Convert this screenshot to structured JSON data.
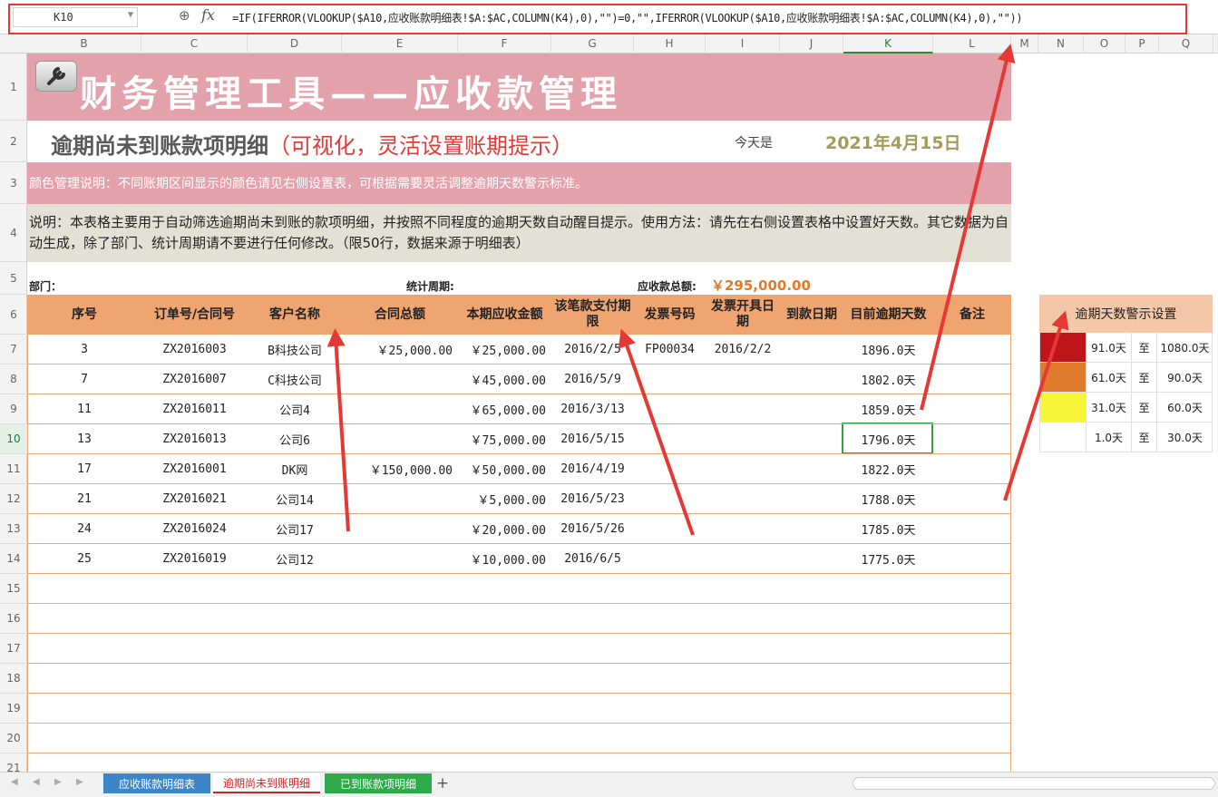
{
  "formula_bar": {
    "cell_ref": "K10",
    "formula": "=IF(IFERROR(VLOOKUP($A10,应收账款明细表!$A:$AC,COLUMN(K4),0),\"\")=0,\"\",IFERROR(VLOOKUP($A10,应收账款明细表!$A:$AC,COLUMN(K4),0),\"\"))"
  },
  "columns": [
    "B",
    "C",
    "D",
    "E",
    "F",
    "G",
    "H",
    "I",
    "J",
    "K",
    "L",
    "M",
    "N",
    "O",
    "P",
    "Q"
  ],
  "rows": [
    "1",
    "2",
    "3",
    "4",
    "5",
    "6",
    "7",
    "8",
    "9",
    "10",
    "11",
    "12",
    "13",
    "14",
    "15",
    "16",
    "17",
    "18",
    "19",
    "20",
    "21"
  ],
  "title": "财务管理工具——应收款管理",
  "subtitle_main": "逾期尚未到账款项明细",
  "subtitle_highlight": "（可视化，灵活设置账期提示）",
  "today_label": "今天是",
  "today_date": "2021年4月15日",
  "color_note": "颜色管理说明：不同账期区间显示的颜色请见右侧设置表，可根据需要灵活调整逾期天数警示标准。",
  "description": "说明：本表格主要用于自动筛选逾期尚未到账的款项明细，并按照不同程度的逾期天数自动醒目提示。使用方法：请先在右侧设置表格中设置好天数。其它数据为自动生成，除了部门、统计周期请不要进行任何修改。（限50行，数据来源于明细表）",
  "info_row": {
    "dept_label": "部门：",
    "period_label": "统计周期:",
    "total_label": "应收款总额:",
    "total_value": "￥295,000.00"
  },
  "table": {
    "headers": [
      "序号",
      "订单号/合同号",
      "客户名称",
      "合同总额",
      "本期应收金额",
      "该笔款支付期限",
      "发票号码",
      "发票开具日期",
      "到款日期",
      "目前逾期天数",
      "备注"
    ],
    "rows": [
      [
        "3",
        "ZX2016003",
        "B科技公司",
        "￥25,000.00",
        "￥25,000.00",
        "2016/2/5",
        "FP00034",
        "2016/2/2",
        "",
        "1896.0天",
        ""
      ],
      [
        "7",
        "ZX2016007",
        "C科技公司",
        "",
        "￥45,000.00",
        "2016/5/9",
        "",
        "",
        "",
        "1802.0天",
        ""
      ],
      [
        "11",
        "ZX2016011",
        "公司4",
        "",
        "￥65,000.00",
        "2016/3/13",
        "",
        "",
        "",
        "1859.0天",
        ""
      ],
      [
        "13",
        "ZX2016013",
        "公司6",
        "",
        "￥75,000.00",
        "2016/5/15",
        "",
        "",
        "",
        "1796.0天",
        ""
      ],
      [
        "17",
        "ZX2016001",
        "DK网",
        "￥150,000.00",
        "￥50,000.00",
        "2016/4/19",
        "",
        "",
        "",
        "1822.0天",
        ""
      ],
      [
        "21",
        "ZX2016021",
        "公司14",
        "",
        "￥5,000.00",
        "2016/5/23",
        "",
        "",
        "",
        "1788.0天",
        ""
      ],
      [
        "24",
        "ZX2016024",
        "公司17",
        "",
        "￥20,000.00",
        "2016/5/26",
        "",
        "",
        "",
        "1785.0天",
        ""
      ],
      [
        "25",
        "ZX2016019",
        "公司12",
        "",
        "￥10,000.00",
        "2016/6/5",
        "",
        "",
        "",
        "1775.0天",
        ""
      ]
    ]
  },
  "warning_panel": {
    "title": "逾期天数警示设置",
    "rows": [
      {
        "color": "#c0141b",
        "from": "91.0天",
        "to_label": "至",
        "to": "1080.0天"
      },
      {
        "color": "#e07b2b",
        "from": "61.0天",
        "to_label": "至",
        "to": "90.0天"
      },
      {
        "color": "#f7f53a",
        "from": "31.0天",
        "to_label": "至",
        "to": "60.0天"
      },
      {
        "color": "#ffffff",
        "from": "1.0天",
        "to_label": "至",
        "to": "30.0天"
      }
    ]
  },
  "tabs": [
    "应收账款明细表",
    "逾期尚未到账明细",
    "已到账款项明细"
  ],
  "colors": {
    "title_band": "#e3a1ac",
    "table_header": "#f0a571",
    "accent_red": "#e53935"
  }
}
